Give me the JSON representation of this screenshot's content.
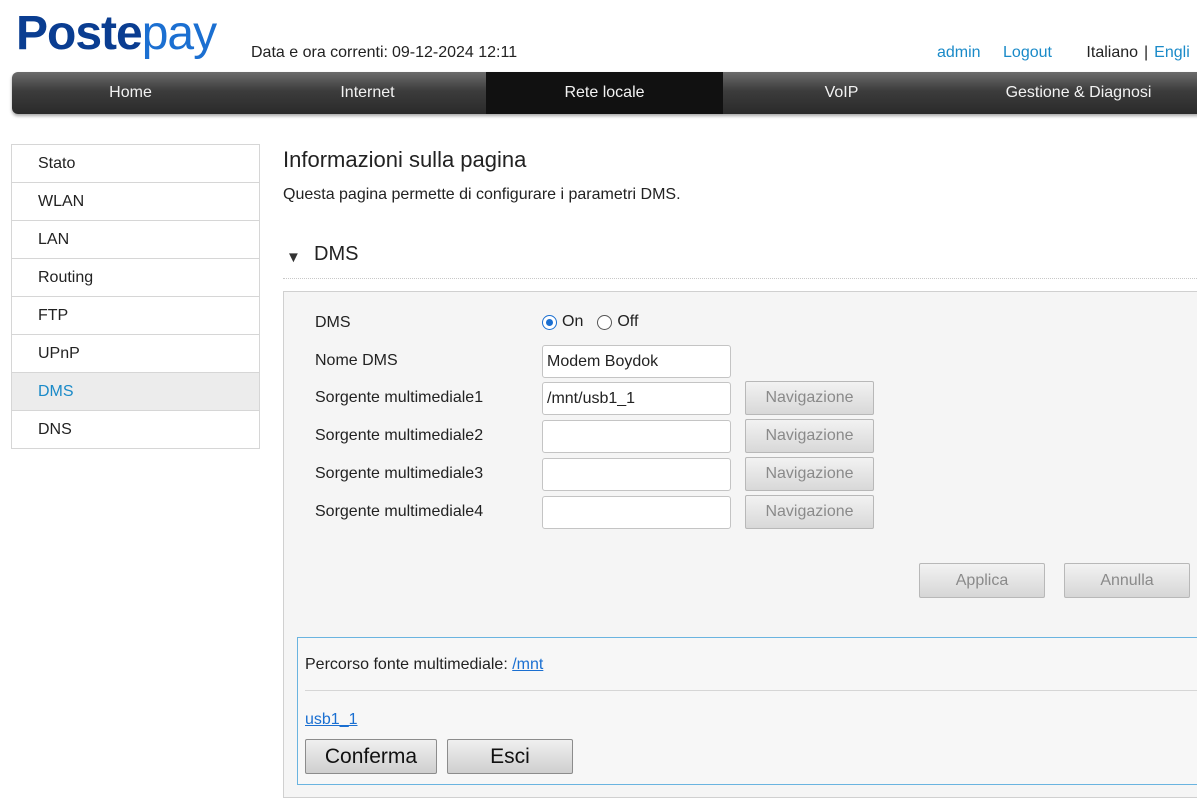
{
  "header": {
    "logo_part1": "Poste",
    "logo_part2": "pay",
    "datetime_label": "Data e ora correnti:",
    "datetime_value": "09-12-2024 12:11",
    "user": "admin",
    "logout": "Logout",
    "lang_current": "Italiano",
    "lang_separator": "|",
    "lang_other": "Engli"
  },
  "nav": {
    "items": [
      {
        "label": "Home"
      },
      {
        "label": "Internet"
      },
      {
        "label": "Rete locale"
      },
      {
        "label": "VoIP"
      },
      {
        "label": "Gestione & Diagnosi"
      }
    ],
    "active": "Rete locale"
  },
  "sidebar": {
    "items": [
      {
        "label": "Stato"
      },
      {
        "label": "WLAN"
      },
      {
        "label": "LAN"
      },
      {
        "label": "Routing"
      },
      {
        "label": "FTP"
      },
      {
        "label": "UPnP"
      },
      {
        "label": "DMS"
      },
      {
        "label": "DNS"
      }
    ],
    "active": "DMS"
  },
  "page": {
    "title": "Informazioni sulla pagina",
    "description": "Questa pagina permette di configurare i parametri DMS."
  },
  "section": {
    "title": "DMS",
    "expanded": true
  },
  "form": {
    "dms_label": "DMS",
    "on_label": "On",
    "off_label": "Off",
    "dms_selected": "On",
    "name_label": "Nome DMS",
    "name_value": "Modem Boydok",
    "sources": [
      {
        "label": "Sorgente multimediale1",
        "value": "/mnt/usb1_1"
      },
      {
        "label": "Sorgente multimediale2",
        "value": ""
      },
      {
        "label": "Sorgente multimediale3",
        "value": ""
      },
      {
        "label": "Sorgente multimediale4",
        "value": ""
      }
    ],
    "browse_label": "Navigazione",
    "apply_label": "Applica",
    "cancel_label": "Annulla"
  },
  "browser": {
    "path_label": "Percorso fonte multimediale:",
    "path_value": "/mnt",
    "items": [
      {
        "label": "usb1_1"
      }
    ],
    "confirm_label": "Conferma",
    "exit_label": "Esci"
  },
  "colors": {
    "accent": "#1a8ac8",
    "link": "#1a6fd1",
    "logo_dark": "#0a3d91",
    "nav_bg": "#3c3c3c",
    "nav_active": "#111111"
  }
}
